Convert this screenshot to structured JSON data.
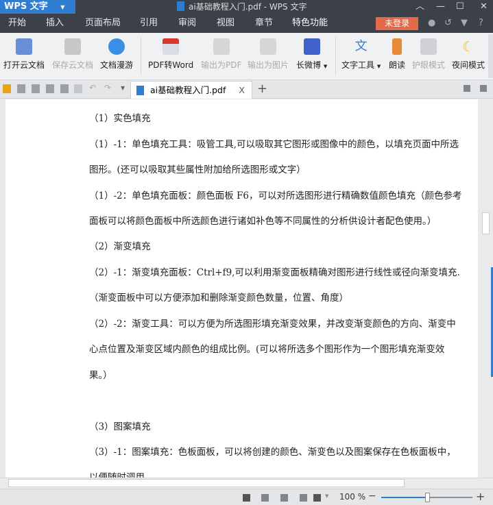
{
  "app": {
    "name": "WPS 文字",
    "window_title": "ai基础教程入门.pdf - WPS 文字"
  },
  "menu": {
    "tabs": [
      "开始",
      "插入",
      "页面布局",
      "引用",
      "审阅",
      "视图",
      "章节",
      "特色功能"
    ],
    "active": "特色功能",
    "login": "未登录",
    "help": "?"
  },
  "ribbon": {
    "buttons": [
      {
        "label": "打开云文档",
        "icon": "open-cloud-doc-icon",
        "enabled": true
      },
      {
        "label": "保存云文档",
        "icon": "save-cloud-doc-icon",
        "enabled": false
      },
      {
        "label": "文档漫游",
        "icon": "cloud-roaming-icon",
        "enabled": true
      },
      {
        "label": "PDF转Word",
        "icon": "pdf-to-word-icon",
        "enabled": true
      },
      {
        "label": "输出为PDF",
        "icon": "export-pdf-icon",
        "enabled": false
      },
      {
        "label": "输出为图片",
        "icon": "export-image-icon",
        "enabled": false
      },
      {
        "label": "长微博",
        "icon": "weibo-icon",
        "enabled": true
      },
      {
        "label": "文字工具",
        "icon": "text-tools-icon",
        "enabled": true
      },
      {
        "label": "朗读",
        "icon": "read-aloud-icon",
        "enabled": true
      },
      {
        "label": "护眼模式",
        "icon": "eye-care-icon",
        "enabled": false
      },
      {
        "label": "夜间模式",
        "icon": "night-mode-icon",
        "enabled": true
      }
    ]
  },
  "tab": {
    "filename": "ai基础教程入门.pdf",
    "close": "X",
    "add": "+"
  },
  "document": {
    "lines": [
      "（1）实色填充",
      "（1）-1：单色填充工具：吸管工具,可以吸取其它图形或图像中的颜色，以填充页面中所选",
      "图形。(还可以吸取其些属性附加给所选图形或文字）",
      "（1）-2：单色填充面板：颜色面板 F6，可以对所选图形进行精确数值颜色填充（颜色参考",
      "面板可以将颜色面板中所选颜色进行诸如补色等不同属性的分析供设计者配色使用。）",
      "（2）渐变填充",
      "（2）-1：渐变填充面板：Ctrl+f9,可以利用渐变面板精确对图形进行线性或径向渐变填充.",
      "（渐变面板中可以方便添加和删除渐变颜色数量，位置、角度）",
      "（2）-2：渐变工具：可以方便为所选图形填充渐变效果，并改变渐变颜色的方向、渐变中",
      "心点位置及渐变区域内颜色的组成比例。(可以将所选多个图形作为一个图形填充渐变效",
      "果。）",
      "",
      "（3）图案填充",
      "（3）-1：图案填充：色板面板，可以将创建的颜色、渐变色以及图案保存在色板面板中，",
      "以便随时调用"
    ]
  },
  "status": {
    "zoom": "100 %",
    "zoom_level": 0.5,
    "minus": "−",
    "plus": "+"
  },
  "colors": {
    "accent": "#2f7dd1",
    "login": "#e2694a",
    "titlebar": "#3c4048"
  }
}
